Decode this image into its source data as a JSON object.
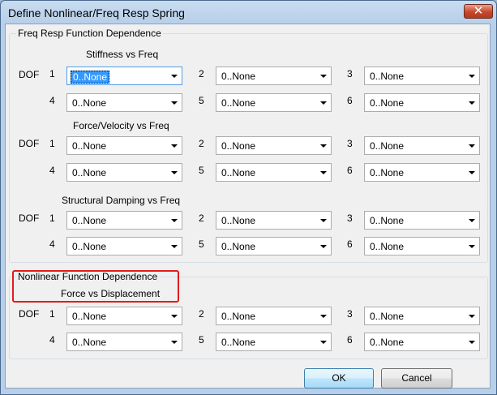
{
  "window": {
    "title": "Define Nonlinear/Freq Resp Spring",
    "close_glyph": "✕"
  },
  "freq_group": {
    "label": "Freq Resp Function Dependence"
  },
  "nonlinear_group": {
    "label": "Nonlinear Function Dependence"
  },
  "dof_label": "DOF",
  "dof_numbers": [
    "1",
    "2",
    "3",
    "4",
    "5",
    "6"
  ],
  "sections": [
    {
      "title": "Stiffness vs Freq",
      "values": [
        "0..None",
        "0..None",
        "0..None",
        "0..None",
        "0..None",
        "0..None"
      ]
    },
    {
      "title": "Force/Velocity vs Freq",
      "values": [
        "0..None",
        "0..None",
        "0..None",
        "0..None",
        "0..None",
        "0..None"
      ]
    },
    {
      "title": "Structural Damping vs Freq",
      "values": [
        "0..None",
        "0..None",
        "0..None",
        "0..None",
        "0..None",
        "0..None"
      ]
    },
    {
      "title": "Force vs Displacement",
      "values": [
        "0..None",
        "0..None",
        "0..None",
        "0..None",
        "0..None",
        "0..None"
      ]
    }
  ],
  "buttons": {
    "ok": "OK",
    "cancel": "Cancel"
  },
  "colors": {
    "highlight": "#e31b1b",
    "selection": "#3399ff"
  }
}
